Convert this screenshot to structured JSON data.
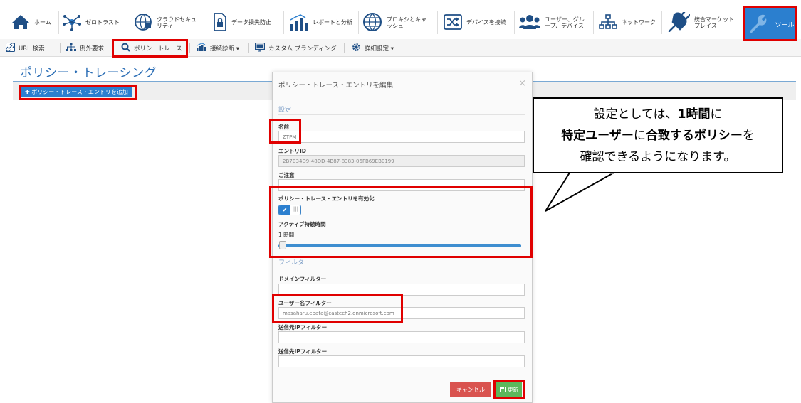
{
  "topnav": {
    "items": [
      {
        "label": "ホーム",
        "icon": "home-icon"
      },
      {
        "label": "ゼロトラスト",
        "icon": "network-hub-icon"
      },
      {
        "label": "クラウドセキュ\nリティ",
        "icon": "cloud-lock-icon"
      },
      {
        "label": "データ損失防止",
        "icon": "document-lock-icon"
      },
      {
        "label": "レポートと分析",
        "icon": "bar-chart-icon"
      },
      {
        "label": "プロキシとキャ\nッシュ",
        "icon": "globe-icon"
      },
      {
        "label": "デバイスを接続",
        "icon": "shuffle-icon"
      },
      {
        "label": "ユーザー、グル\nープ、デバイス",
        "icon": "users-icon"
      },
      {
        "label": "ネットワーク",
        "icon": "sitemap-icon"
      },
      {
        "label": "統合マーケット\nプレイス",
        "icon": "plug-icon"
      },
      {
        "label": "ツール",
        "icon": "wrench-icon"
      }
    ]
  },
  "subnav": {
    "items": [
      {
        "label": "URL 検索",
        "icon": "link-icon"
      },
      {
        "label": "例外要求",
        "icon": "tree-icon"
      },
      {
        "label": "ポリシートレース",
        "icon": "search-icon"
      },
      {
        "label": "接続診断 ▾",
        "icon": "chart-icon"
      },
      {
        "label": "カスタム ブランディング",
        "icon": "monitor-icon"
      },
      {
        "label": "詳細設定 ▾",
        "icon": "gear-icon"
      }
    ]
  },
  "page": {
    "title": "ポリシー・トレーシング",
    "add_button": "✚ ポリシー・トレース・エントリを追加"
  },
  "modal": {
    "title": "ポリシー・トレース・エントリを編集",
    "close": "×",
    "settings_section": "設定",
    "name_label": "名前",
    "name_value": "ZTPM",
    "entry_id_label": "エントリID",
    "entry_id_value": "2B7B34D9-48DD-4B87-8383-06FB69EB0199",
    "notes_label": "ご注意",
    "notes_value": "",
    "enable_label": "ポリシー・トレース・エントリを有効化",
    "toggle_state": "on",
    "duration_label": "アクティブ持続時間",
    "duration_value": "1 時間",
    "duration_slider_fraction": 0.0,
    "filter_section": "フィルター",
    "domain_filter_label": "ドメインフィルター",
    "domain_filter_value": "",
    "user_filter_label": "ユーザー名フィルター",
    "user_filter_value": "masaharu.ebata@castech2.onmicrosoft.com",
    "src_ip_label": "送信元IPフィルター",
    "src_ip_value": "",
    "dst_ip_label": "送信先IPフィルター",
    "dst_ip_value": "",
    "cancel_button": "キャンセル",
    "save_button": "更新"
  },
  "callout": {
    "line1_a": "設定としては、",
    "line1_b": "1時間",
    "line1_c": "に",
    "line2_a": "特定ユーザー",
    "line2_b": "に",
    "line2_c": "合致する",
    "line2_d": "ポリシー",
    "line2_e": "を",
    "line3": "確認できるようになります。"
  },
  "colors": {
    "accent": "#2b7fcf",
    "highlight": "#e00000",
    "cancel": "#d9534f",
    "save": "#5cb85c"
  }
}
